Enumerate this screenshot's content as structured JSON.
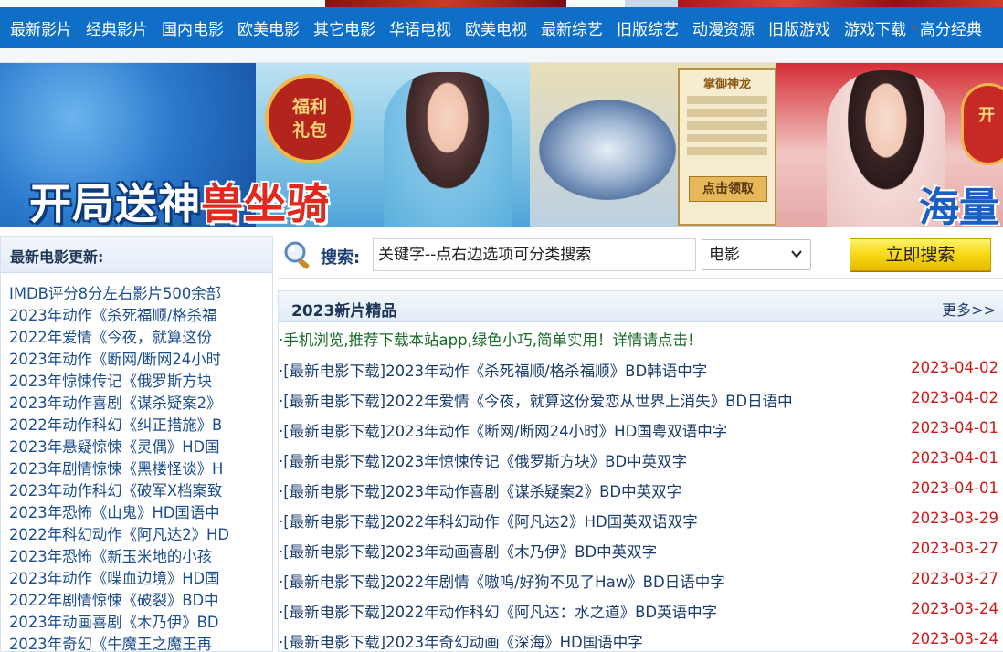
{
  "nav": {
    "items": [
      "最新影片",
      "经典影片",
      "国内电影",
      "欧美电影",
      "其它电影",
      "华语电视",
      "欧美电视",
      "最新综艺",
      "旧版综艺",
      "动漫资源",
      "旧版游戏",
      "游戏下载",
      "高分经典"
    ]
  },
  "banner": {
    "badge_line1": "福利",
    "badge_line2": "礼包",
    "slogan_part1": "开局送神",
    "slogan_part2": "兽坐骑",
    "panel_title": "掌御神龙",
    "panel_button": "点击领取",
    "slogan2": "海量",
    "side_badge": "开"
  },
  "sidebar": {
    "heading": "最新电影更新:",
    "items": [
      "IMDB评分8分左右影片500余部",
      "2023年动作《杀死福顺/格杀福",
      "2022年爱情《今夜，就算这份",
      "2023年动作《断网/断网24小时",
      "2023年惊悚传记《俄罗斯方块",
      "2023年动作喜剧《谋杀疑案2》",
      "2022年动作科幻《纠正措施》B",
      "2023年悬疑惊悚《灵偶》HD国",
      "2023年剧情惊悚《黑楼怪谈》H",
      "2023年动作科幻《破军X档案致",
      "2023年恐怖《山鬼》HD国语中",
      "2022年科幻动作《阿凡达2》HD",
      "2023年恐怖《新玉米地的小孩",
      "2023年动作《喋血边境》HD国",
      "2022年剧情惊悚《破裂》BD中",
      "2023年动画喜剧《木乃伊》BD",
      "2023年奇幻《牛魔王之魔王再"
    ]
  },
  "search": {
    "label": "搜索:",
    "value": "关键字--点右边选项可分类搜索",
    "category_selected": "电影",
    "button": "立即搜索"
  },
  "main": {
    "title": "2023新片精品",
    "more": "更多>>",
    "promo": "·手机浏览,推荐下载本站app,绿色小巧,简单实用！详情请点击!",
    "rows": [
      {
        "title": "·[最新电影下载]2023年动作《杀死福顺/格杀福顺》BD韩语中字",
        "date": "2023-04-02"
      },
      {
        "title": "·[最新电影下载]2022年爱情《今夜，就算这份爱恋从世界上消失》BD日语中",
        "date": "2023-04-02"
      },
      {
        "title": "·[最新电影下载]2023年动作《断网/断网24小时》HD国粤双语中字",
        "date": "2023-04-01"
      },
      {
        "title": "·[最新电影下载]2023年惊悚传记《俄罗斯方块》BD中英双字",
        "date": "2023-04-01"
      },
      {
        "title": "·[最新电影下载]2023年动作喜剧《谋杀疑案2》BD中英双字",
        "date": "2023-04-01"
      },
      {
        "title": "·[最新电影下载]2022年科幻动作《阿凡达2》HD国英双语双字",
        "date": "2023-03-29"
      },
      {
        "title": "·[最新电影下载]2023年动画喜剧《木乃伊》BD中英双字",
        "date": "2023-03-27"
      },
      {
        "title": "·[最新电影下载]2022年剧情《嗷呜/好狗不见了Haw》BD日语中字",
        "date": "2023-03-27"
      },
      {
        "title": "·[最新电影下载]2022年动作科幻《阿凡达：水之道》BD英语中字",
        "date": "2023-03-24"
      },
      {
        "title": "·[最新电影下载]2023年奇幻动画《深海》HD国语中字",
        "date": "2023-03-24"
      }
    ]
  },
  "colors": {
    "nav_bg": "#0f6fc6",
    "link": "#1b4d8f",
    "date_red": "#d11818",
    "promo_green": "#1a6a2a",
    "button_yellow": "#f6d40f"
  }
}
